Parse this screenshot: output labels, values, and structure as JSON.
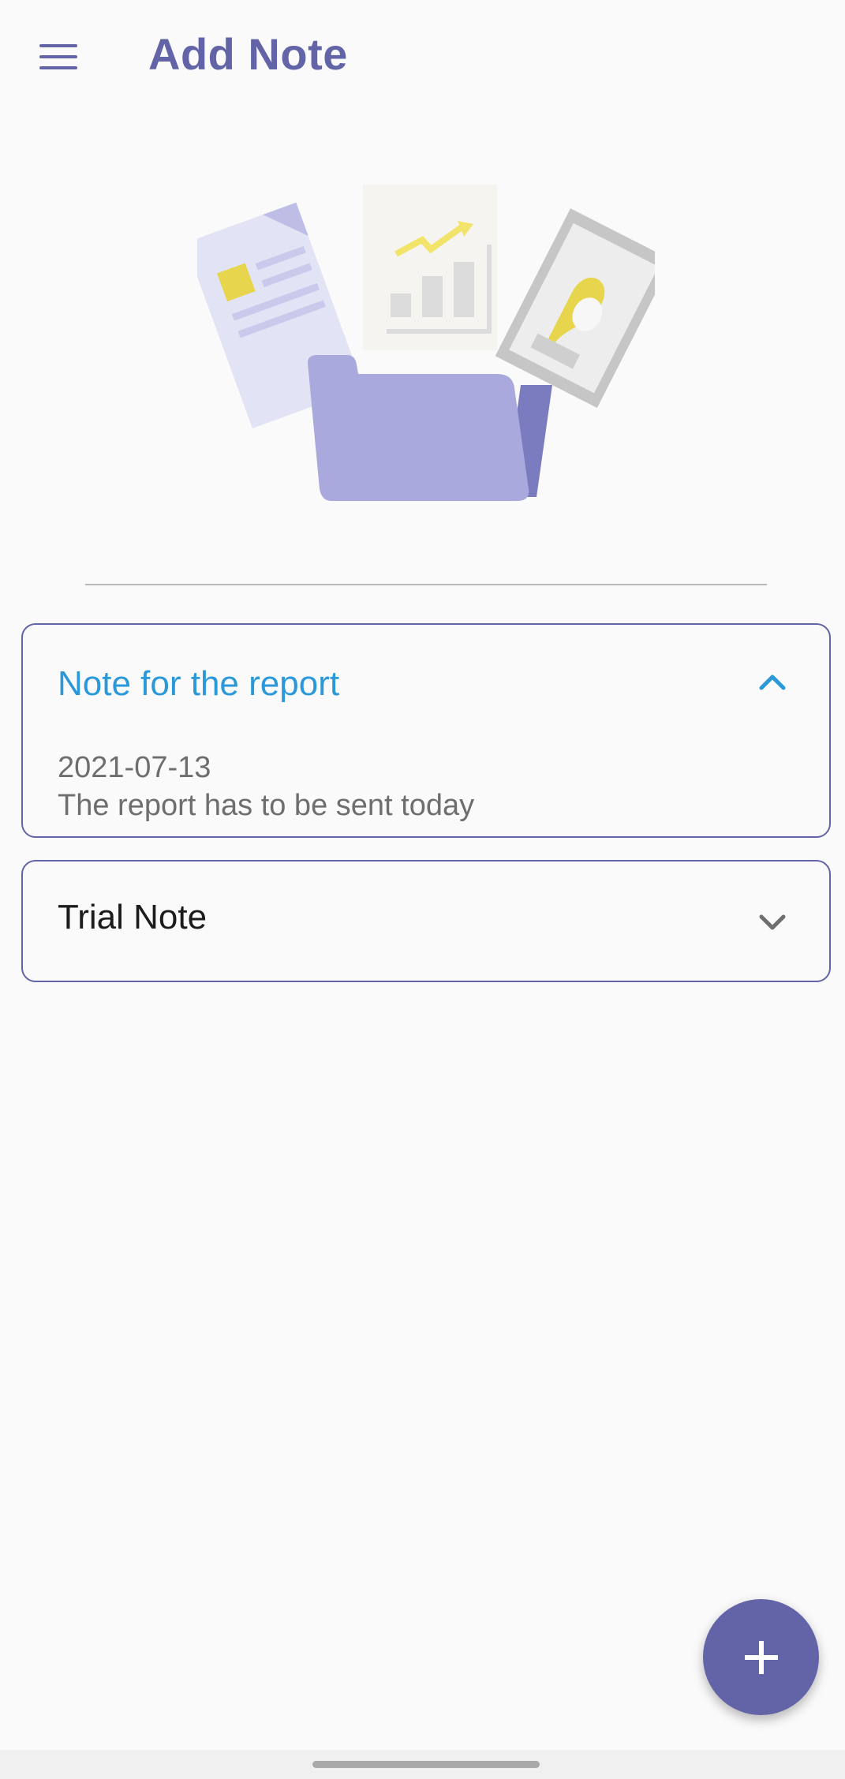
{
  "appbar": {
    "title": "Add Note",
    "menu_icon": "hamburger-menu-icon"
  },
  "illustration": {
    "description_icon": "documents-folder-illustration"
  },
  "notes": [
    {
      "title": "Note for the report",
      "expanded": true,
      "date": "2021-07-13",
      "body": "The report has to be sent today",
      "chevron_icon": "chevron-up-icon"
    },
    {
      "title": "Trial Note",
      "expanded": false,
      "chevron_icon": "chevron-down-icon"
    }
  ],
  "fab": {
    "icon": "plus-icon"
  },
  "colors": {
    "primary": "#6264a7",
    "accent_blue": "#2b98d9",
    "background": "#fafafa"
  }
}
